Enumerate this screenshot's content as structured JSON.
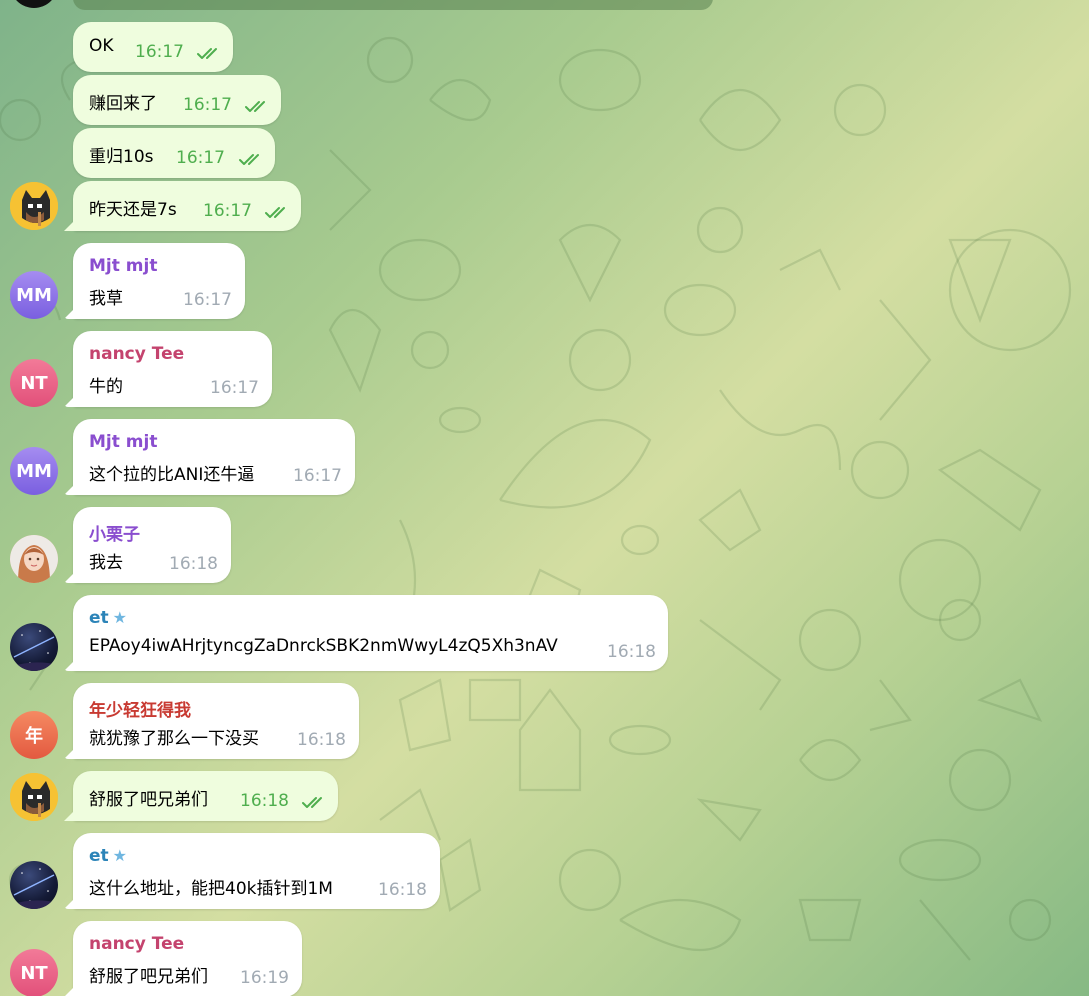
{
  "messages": [
    {
      "type": "out",
      "text": "OK",
      "time": "16:17"
    },
    {
      "type": "out",
      "text": "赚回来了",
      "time": "16:17"
    },
    {
      "type": "out",
      "text": "重归10s",
      "time": "16:17"
    },
    {
      "type": "out",
      "text": "昨天还是7s",
      "time": "16:17"
    },
    {
      "sender": "Mjt mjt",
      "text": "我草",
      "time": "16:17",
      "avatar": "MM"
    },
    {
      "sender": "nancy Tee",
      "text": "牛的",
      "time": "16:17",
      "avatar": "NT"
    },
    {
      "sender": "Mjt mjt",
      "text": "这个拉的比ANI还牛逼",
      "time": "16:17",
      "avatar": "MM"
    },
    {
      "sender": "小栗子",
      "text": "我去",
      "time": "16:18"
    },
    {
      "sender": "et",
      "text": "EPAoy4iwAHrjtyncgZaDnrckSBK2nmWwyL4zQ5Xh3nAV",
      "time": "16:18"
    },
    {
      "sender": "年少轻狂得我",
      "text": "就犹豫了那么一下没买",
      "time": "16:18",
      "avatar": "年"
    },
    {
      "type": "out",
      "text": "舒服了吧兄弟们",
      "time": "16:18"
    },
    {
      "sender": "et",
      "text": "这什么地址，能把40k插针到1M",
      "time": "16:18"
    },
    {
      "sender": "nancy Tee",
      "text": "舒服了吧兄弟们",
      "time": "16:19",
      "avatar": "NT"
    }
  ],
  "colors": {
    "mjt": "#8a4ecf",
    "nancy": "#c4436e",
    "xiaolizi": "#8a4ecf",
    "et": "#2c84b8",
    "nian": "#c83a32",
    "outgoing_bubble": "#effdde",
    "outgoing_time": "#4fae4e"
  },
  "icons": {
    "read": "double-check-icon",
    "premium": "star-icon"
  }
}
